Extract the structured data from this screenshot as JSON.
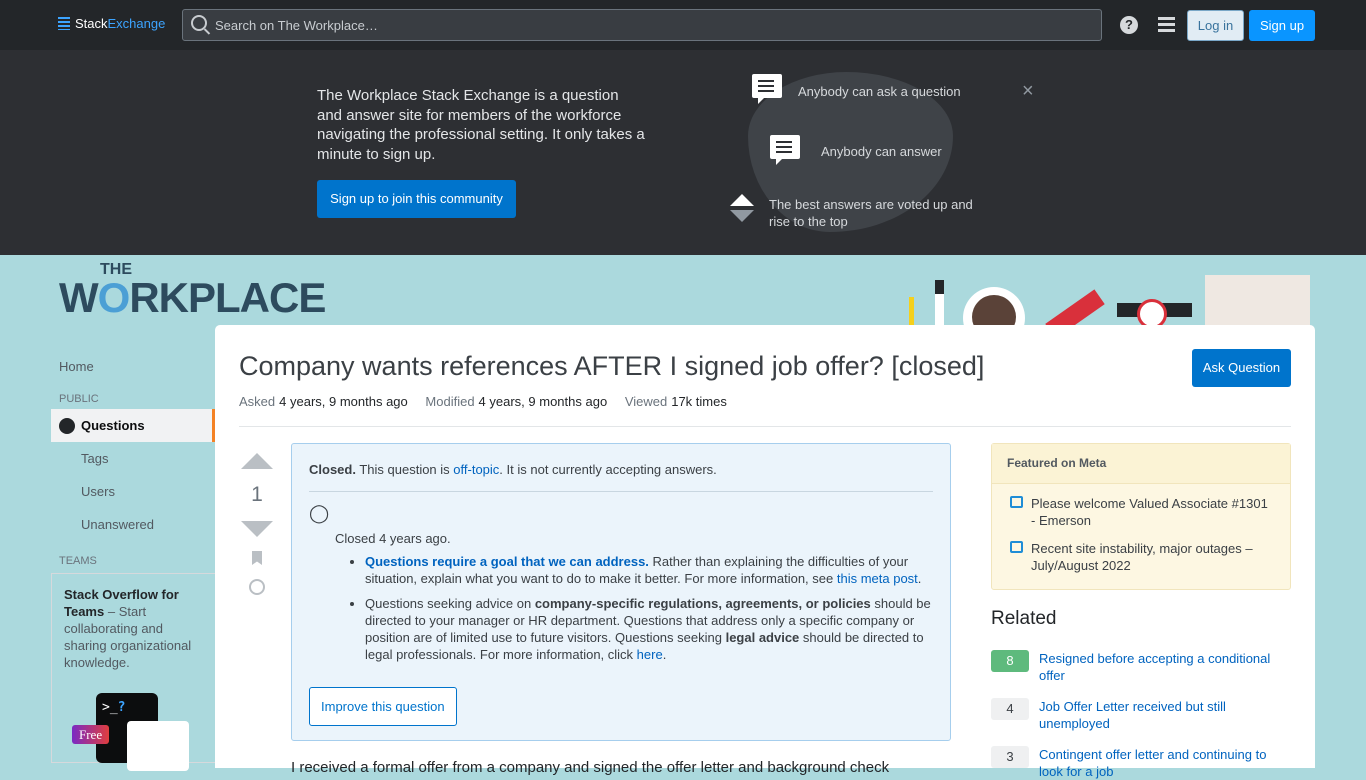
{
  "topbar": {
    "logo_stack": "Stack",
    "logo_exchange": "Exchange",
    "search_placeholder": "Search on The Workplace…",
    "help": "?",
    "login": "Log in",
    "signup": "Sign up"
  },
  "hero": {
    "text": "The Workplace Stack Exchange is a question and answer site for members of the workforce navigating the professional setting. It only takes a minute to sign up.",
    "button": "Sign up to join this community",
    "feature_ask": "Anybody can ask a question",
    "feature_answer": "Anybody can answer",
    "feature_vote": "The best answers are voted up and rise to the top",
    "close": "×"
  },
  "site_logo": {
    "the": "THE",
    "w": "W",
    "o": "O",
    "rest": "RKPLACE"
  },
  "sidebar": {
    "home": "Home",
    "public": "PUBLIC",
    "questions": "Questions",
    "tags": "Tags",
    "users": "Users",
    "unanswered": "Unanswered",
    "teams_section": "TEAMS",
    "teams_bold1": "Stack Overflow for",
    "teams_bold2": "Teams",
    "teams_text": " – Start collaborating and sharing organizational knowledge.",
    "term_prompt": ">_",
    "term_q": "?",
    "free": "Free"
  },
  "question": {
    "title": "Company wants references AFTER I signed job offer? [closed]",
    "ask_button": "Ask Question",
    "asked_label": "Asked",
    "asked": "4 years, 9 months ago",
    "modified_label": "Modified",
    "modified": "4 years, 9 months ago",
    "viewed_label": "Viewed",
    "viewed": "17k times",
    "votes": "1",
    "body_start": "I received a formal offer from a company and signed the offer letter and background check"
  },
  "notice": {
    "closed": "Closed.",
    "text1": " This question is ",
    "offtopic": "off-topic",
    "text2": ". It is not currently accepting answers.",
    "closed_ago": "Closed 4 years ago.",
    "r1_link": "Questions require a goal that we can address.",
    "r1_text": " Rather than explaining the difficulties of your situation, explain what you want to do to make it better. For more information, see ",
    "r1_link2": "this meta post",
    "r2_a": "Questions seeking advice on ",
    "r2_b": "company-specific regulations, agreements, or policies",
    "r2_c": " should be directed to your manager or HR department. Questions that address only a specific company or position are of limited use to future visitors. Questions seeking ",
    "r2_d": "legal advice",
    "r2_e": " should be directed to legal professionals. For more information, click ",
    "r2_link": "here",
    "improve": "Improve this question"
  },
  "featured": {
    "title": "Featured on Meta",
    "items": [
      "Please welcome Valued Associate #1301 - Emerson",
      "Recent site instability, major outages – July/August 2022"
    ]
  },
  "related": {
    "title": "Related",
    "items": [
      {
        "score": "8",
        "title": "Resigned before accepting a conditional offer",
        "accepted": true
      },
      {
        "score": "4",
        "title": "Job Offer Letter received but still unemployed",
        "accepted": false
      },
      {
        "score": "3",
        "title": "Contingent offer letter and continuing to look for a job",
        "accepted": false
      }
    ]
  },
  "colors": {
    "accent": "#0074cc",
    "page_bg": "#abd9dd",
    "accepted": "#5eba7d"
  }
}
